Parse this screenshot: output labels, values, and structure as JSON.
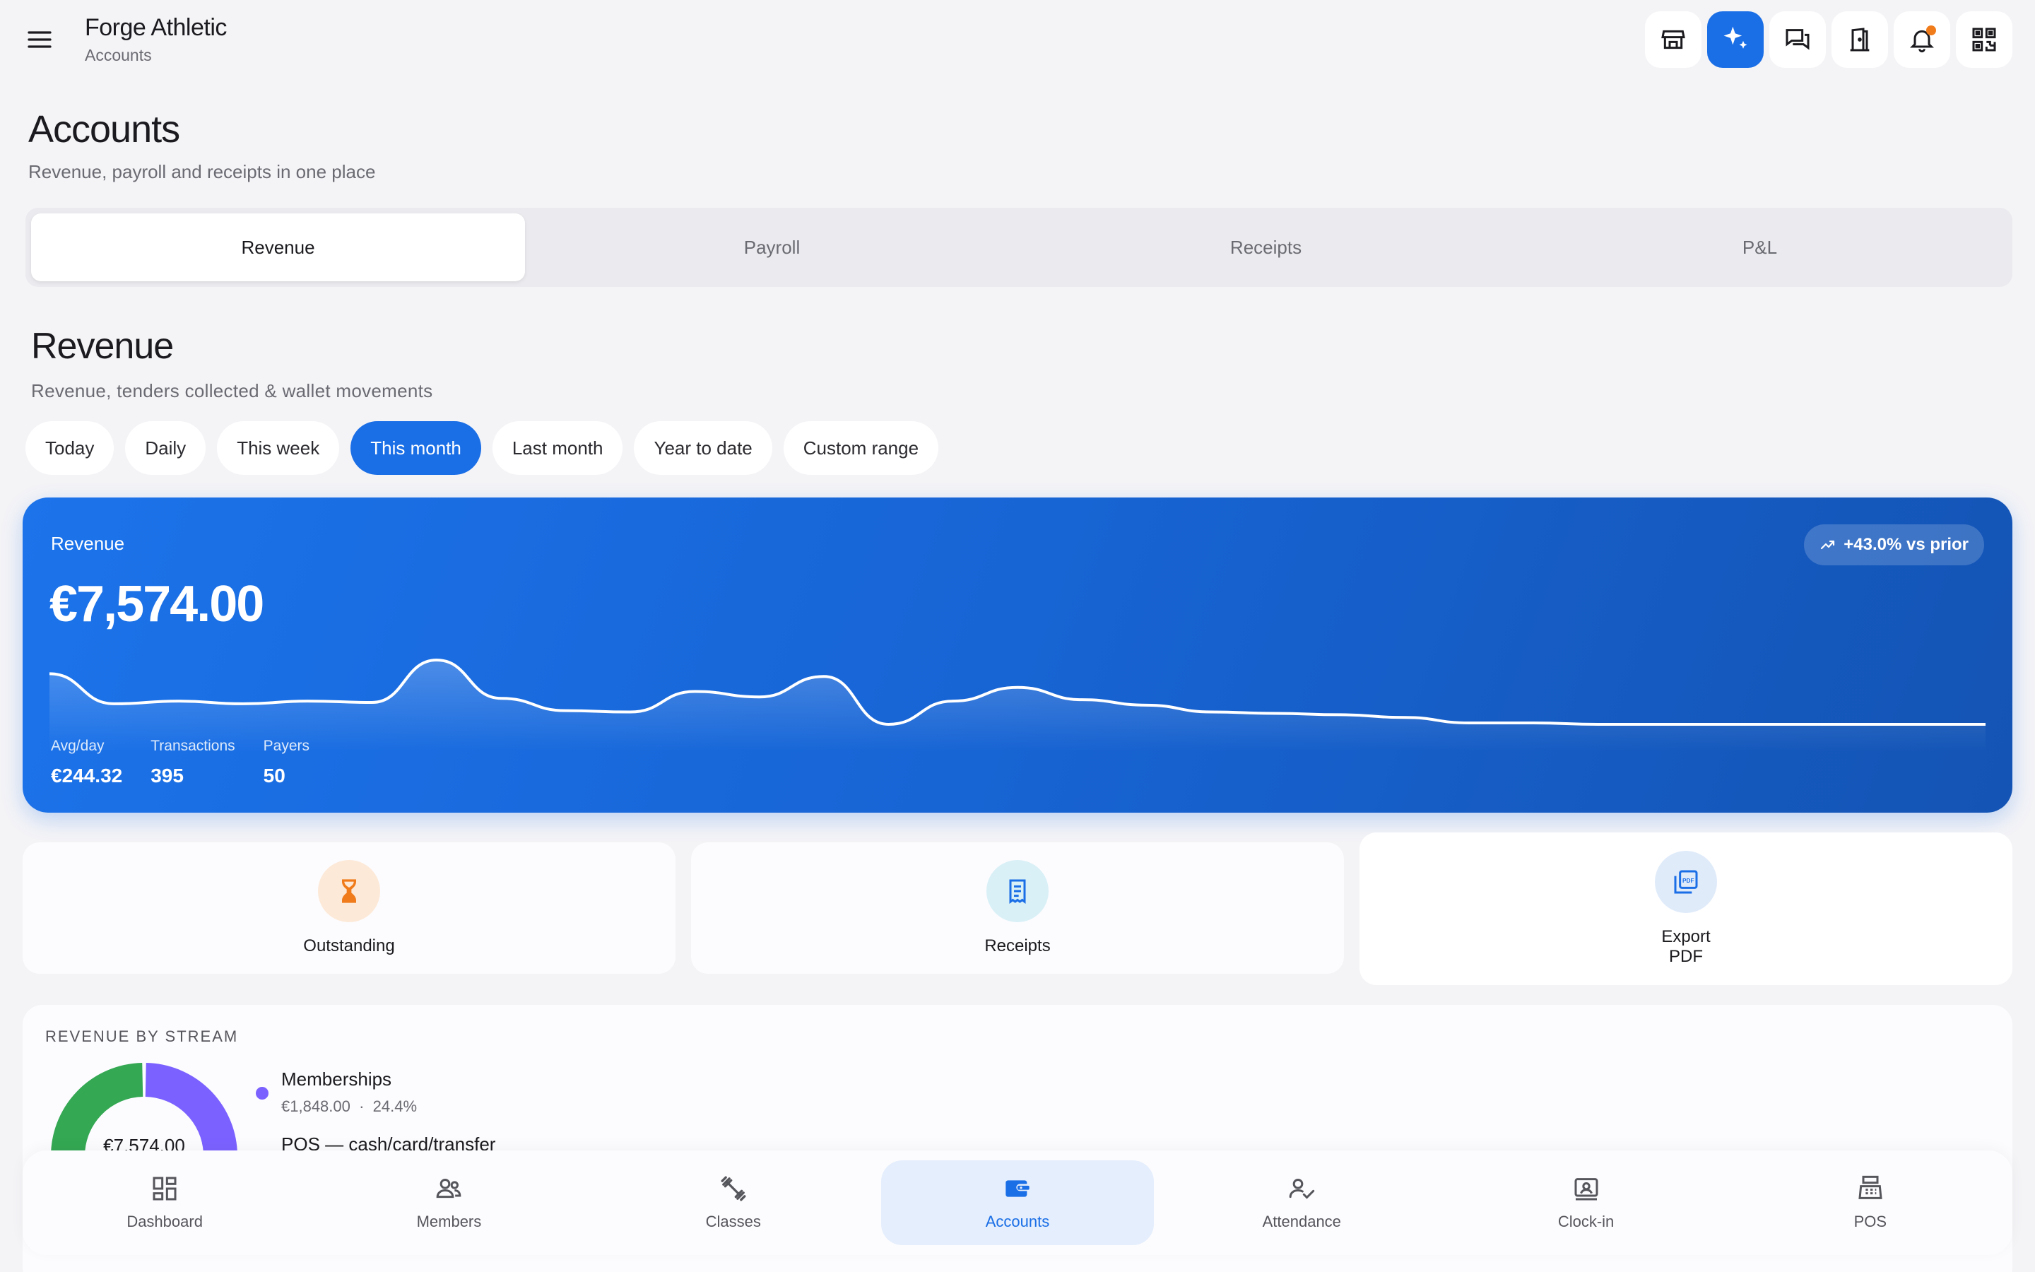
{
  "app": {
    "name": "Forge Athletic",
    "section": "Accounts"
  },
  "colors": {
    "accent": "#1a6ee6",
    "orange": "#f07b1a",
    "purple": "#7b61ff",
    "green": "#34a853"
  },
  "topbar": {
    "icons": [
      "store-icon",
      "sparkle-icon",
      "chat-icon",
      "door-icon",
      "bell-icon",
      "qr-code-icon"
    ]
  },
  "page": {
    "title": "Accounts",
    "subtitle": "Revenue, payroll and receipts in one place"
  },
  "tabs": [
    {
      "label": "Revenue",
      "active": true
    },
    {
      "label": "Payroll",
      "active": false
    },
    {
      "label": "Receipts",
      "active": false
    },
    {
      "label": "P&L",
      "active": false
    }
  ],
  "revenue_section": {
    "title": "Revenue",
    "subtitle": "Revenue, tenders collected & wallet movements"
  },
  "ranges": [
    {
      "label": "Today",
      "active": false
    },
    {
      "label": "Daily",
      "active": false
    },
    {
      "label": "This week",
      "active": false
    },
    {
      "label": "This month",
      "active": true
    },
    {
      "label": "Last month",
      "active": false
    },
    {
      "label": "Year to date",
      "active": false
    },
    {
      "label": "Custom range",
      "active": false
    }
  ],
  "revenue_card": {
    "label": "Revenue",
    "amount": "€7,574.00",
    "trend": "+43.0% vs prior",
    "stats": [
      {
        "label": "Avg/day",
        "value": "€244.32"
      },
      {
        "label": "Transactions",
        "value": "395"
      },
      {
        "label": "Payers",
        "value": "50"
      }
    ],
    "sparkline": [
      520,
      300,
      320,
      300,
      320,
      310,
      620,
      340,
      250,
      240,
      390,
      350,
      500,
      150,
      320,
      420,
      330,
      290,
      240,
      230,
      220,
      200,
      160,
      160,
      150,
      150,
      150,
      150,
      150,
      150,
      150
    ]
  },
  "actions": [
    {
      "label": "Outstanding",
      "icon": "hourglass-icon"
    },
    {
      "label": "Receipts",
      "icon": "receipt-icon"
    },
    {
      "label": "Export\nPDF",
      "icon": "pdf-icon"
    }
  ],
  "stream": {
    "title": "REVENUE BY STREAM",
    "total": "€7,574.00",
    "items": [
      {
        "name": "Memberships",
        "amount": "€1,848.00",
        "percent": "24.4%",
        "share": 24.4,
        "color": "#7b61ff"
      },
      {
        "name": "POS — cash/card/transfer",
        "amount": "",
        "percent": "",
        "share": 75.6,
        "color": "#34a853"
      }
    ]
  },
  "bottom_nav": [
    {
      "label": "Dashboard",
      "icon": "dashboard-icon",
      "active": false
    },
    {
      "label": "Members",
      "icon": "members-icon",
      "active": false
    },
    {
      "label": "Classes",
      "icon": "dumbbell-icon",
      "active": false
    },
    {
      "label": "Accounts",
      "icon": "wallet-icon",
      "active": true
    },
    {
      "label": "Attendance",
      "icon": "attendance-icon",
      "active": false
    },
    {
      "label": "Clock-in",
      "icon": "clock-in-icon",
      "active": false
    },
    {
      "label": "POS",
      "icon": "cash-register-icon",
      "active": false
    }
  ]
}
